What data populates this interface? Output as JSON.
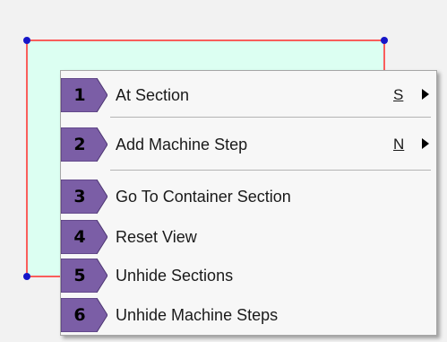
{
  "colors": {
    "shape_fill": "#dcfff2",
    "shape_stroke": "#ff2b2b",
    "handle": "#1616c8",
    "badge_fill": "#7b5ea6",
    "badge_edge": "#4b3470"
  },
  "menu": {
    "items": [
      {
        "number": "1",
        "label": "At Section",
        "shortcut": "S",
        "submenu": true
      },
      {
        "number": "2",
        "label": "Add Machine Step",
        "shortcut": "N",
        "submenu": true
      },
      {
        "number": "3",
        "label": "Go To Container Section",
        "shortcut": "",
        "submenu": false
      },
      {
        "number": "4",
        "label": "Reset View",
        "shortcut": "",
        "submenu": false
      },
      {
        "number": "5",
        "label": "Unhide Sections",
        "shortcut": "",
        "submenu": false
      },
      {
        "number": "6",
        "label": "Unhide Machine Steps",
        "shortcut": "",
        "submenu": false
      }
    ]
  }
}
